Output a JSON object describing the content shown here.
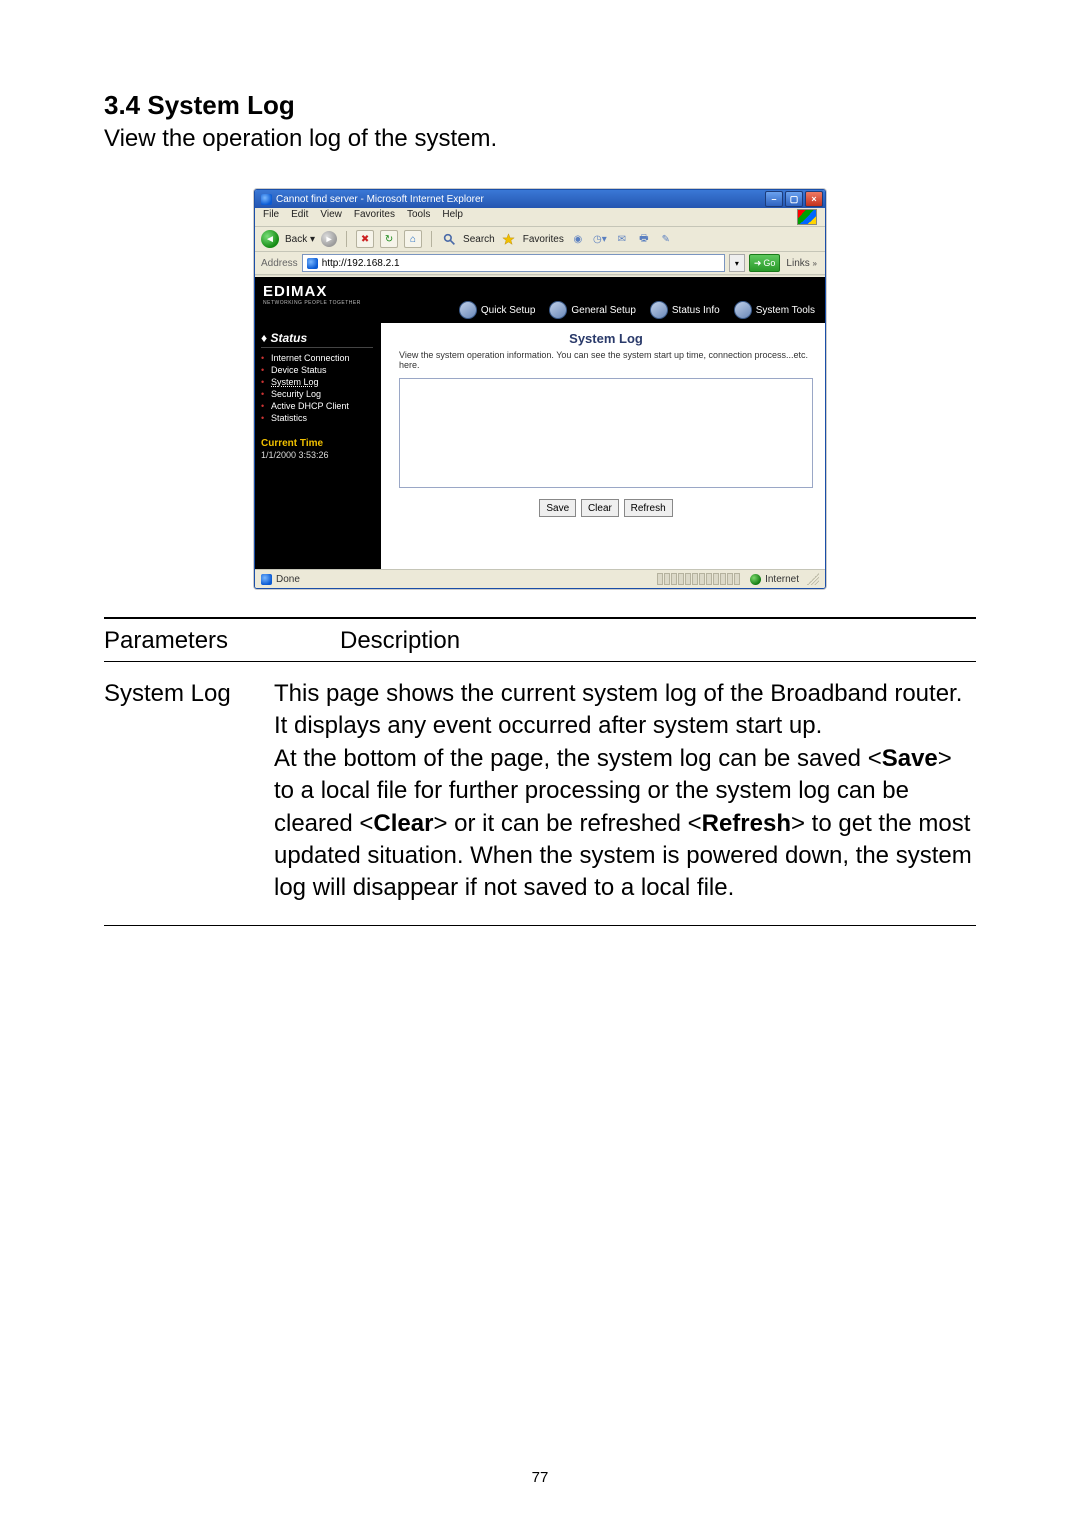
{
  "doc": {
    "heading": "3.4 System Log",
    "subheading": "View the operation log of the system.",
    "table": {
      "head_param": "Parameters",
      "head_desc": "Description",
      "row_param": "System Log",
      "desc_p1": "This page shows the current system log of the Broadband router. It displays any event occurred after system start up.",
      "desc_p2a": "At the bottom of the page, the system log can be saved <",
      "desc_p2_save": "Save",
      "desc_p2b": "> to a local file for further processing or the system log can be cleared <",
      "desc_p2_clear": "Clear",
      "desc_p2c": "> or it can be refreshed <",
      "desc_p2_refresh": "Refresh",
      "desc_p2d": "> to get the most updated situation. When the system is powered down, the system log will disappear if not saved to a local file."
    },
    "pagenum": "77"
  },
  "ie": {
    "title": "Cannot find server - Microsoft Internet Explorer",
    "menus": [
      "File",
      "Edit",
      "View",
      "Favorites",
      "Tools",
      "Help"
    ],
    "toolbar": {
      "back": "Back",
      "search": "Search",
      "favorites": "Favorites"
    },
    "addr": {
      "label": "Address",
      "url": "http://192.168.2.1",
      "go": "Go",
      "links": "Links"
    },
    "statusbar": {
      "done": "Done",
      "zone": "Internet"
    }
  },
  "router": {
    "brand": {
      "name": "EDIMAX",
      "tagline": "NETWORKING PEOPLE TOGETHER"
    },
    "tabs": [
      "Quick Setup",
      "General Setup",
      "Status Info",
      "System Tools"
    ],
    "sidebar": {
      "heading": "Status",
      "items": [
        "Internet Connection",
        "Device Status",
        "System Log",
        "Security Log",
        "Active DHCP Client",
        "Statistics"
      ],
      "curtime_label": "Current Time",
      "curtime_value": "1/1/2000 3:53:26"
    },
    "content": {
      "title": "System Log",
      "desc": "View the system operation information. You can see the system start up time, connection process...etc. here.",
      "save_btn": "Save",
      "clear_btn": "Clear",
      "refresh_btn": "Refresh"
    }
  }
}
